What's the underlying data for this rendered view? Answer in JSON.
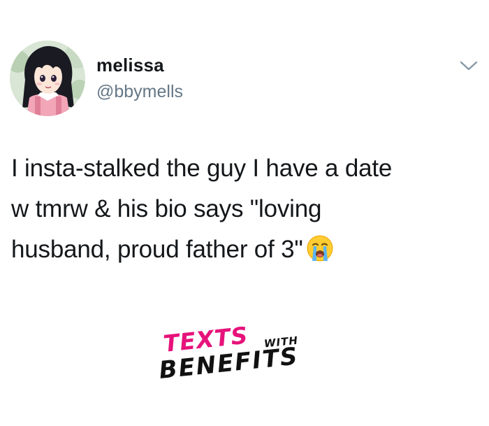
{
  "author": {
    "display_name": "melissa",
    "handle": "@bbymells",
    "avatar_icon": "anime-girl-avatar"
  },
  "menu": {
    "icon": "chevron-down-icon"
  },
  "tweet": {
    "lines": [
      "I insta-stalked the guy I have a date",
      "w tmrw & his bio says \"loving",
      "husband, proud father of 3\""
    ],
    "emoji": "loudly-crying-face"
  },
  "watermark": {
    "line1": "TEXTS",
    "line1_small": "WITH",
    "line2": "BENEFITS",
    "accent_color": "#e6137b"
  },
  "colors": {
    "text": "#14171a",
    "secondary": "#657786",
    "chevron": "#8899a6"
  }
}
